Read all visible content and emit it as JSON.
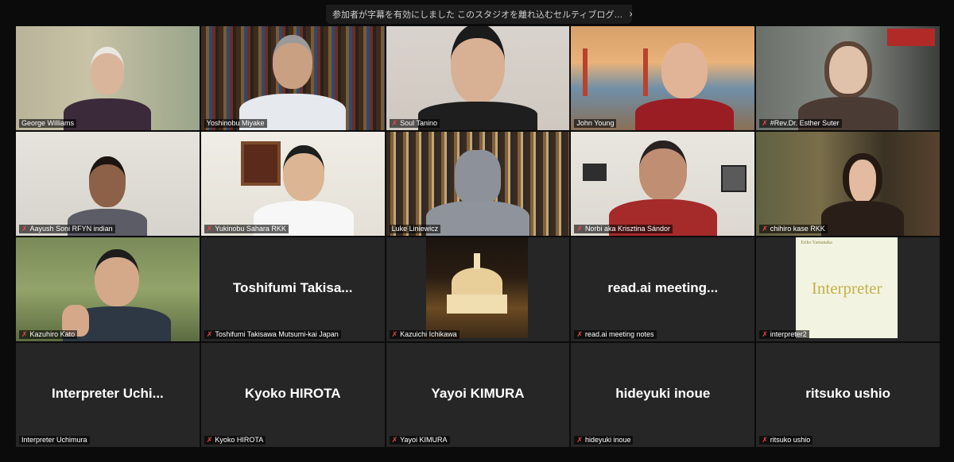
{
  "banner": {
    "text": "参加者が字幕を有効にしました  このスタジオを離れ込むセルティブログ…",
    "close_icon": "×"
  },
  "participants": [
    {
      "name": "George Williams",
      "muted": false,
      "active": true
    },
    {
      "name": "Yoshinobu Miyake",
      "muted": false
    },
    {
      "name": "Soul Tanino",
      "muted": true
    },
    {
      "name": "John Young",
      "muted": false
    },
    {
      "name": "#Rev.Dr. Esther Suter",
      "muted": true
    },
    {
      "name": "Aayush Soni RFYN indian",
      "muted": true
    },
    {
      "name": "Yukinobu Sahara RKK",
      "muted": true
    },
    {
      "name": "Luke Liniewicz",
      "muted": false
    },
    {
      "name": "Norbi aka Krisztina Sándor",
      "muted": true
    },
    {
      "name": "chihiro kase RKK",
      "muted": true
    },
    {
      "name": "Kazuhiro Kato",
      "muted": true
    },
    {
      "name": "Toshifumi Takisawa   Mutsumi-kai  Japan",
      "display": "Toshifumi  Takisa...",
      "muted": true
    },
    {
      "name": "Kazuichi Ichikawa",
      "muted": true
    },
    {
      "name": "read.ai meeting notes",
      "display": "read.ai  meeting...",
      "muted": true
    },
    {
      "name": "interpreter2",
      "muted": true
    },
    {
      "name": "Interpreter Uchimura",
      "display": "Interpreter  Uchi...",
      "muted": false
    },
    {
      "name": "Kyoko HIROTA",
      "display": "Kyoko HIROTA",
      "muted": true
    },
    {
      "name": "Yayoi KIMURA",
      "display": "Yayoi KIMURA",
      "muted": true
    },
    {
      "name": "hideyuki inoue",
      "display": "hideyuki inoue",
      "muted": true
    },
    {
      "name": "ritsuko ushio",
      "display": "ritsuko ushio",
      "muted": true
    }
  ],
  "interpreter_card": {
    "subtitle": "Eriko Yamanaka",
    "title": "Interpreter"
  },
  "colors": {
    "active_border": "#c6d86a",
    "mute_red": "#e5484d",
    "tile_bg": "#262626"
  }
}
